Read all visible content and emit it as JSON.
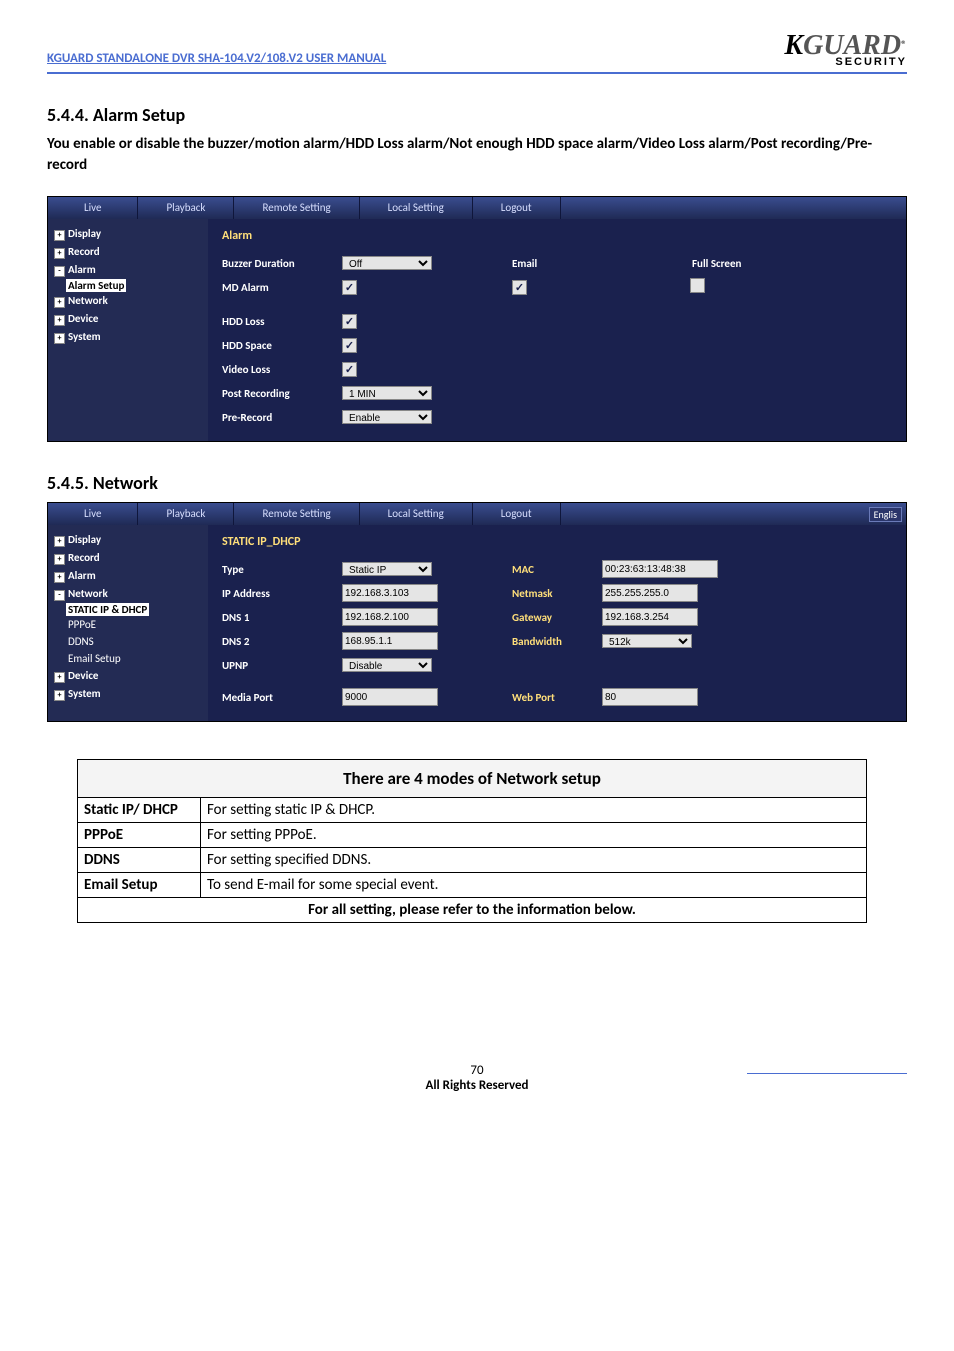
{
  "header": {
    "title": "KGUARD STANDALONE DVR SHA-104.V2/108.V2 USER MANUAL",
    "logo_k": "K",
    "logo_g": "GUARD",
    "logo_r": "®",
    "logo_sec": "SECURITY"
  },
  "sec1": {
    "h": "5.4.4. Alarm Setup",
    "body": "You enable or disable the buzzer/motion alarm/HDD Loss alarm/Not enough HDD space alarm/Video Loss alarm/Post recording/Pre-record"
  },
  "sec2": {
    "h": "5.4.5. Network"
  },
  "tabs": [
    "Live",
    "Playback",
    "Remote Setting",
    "Local Setting",
    "Logout"
  ],
  "lang": "Englis",
  "tree1": {
    "display": "Display",
    "record": "Record",
    "alarm": "Alarm",
    "alarm_setup": "Alarm Setup",
    "network": "Network",
    "device": "Device",
    "system": "System"
  },
  "tree2": {
    "display": "Display",
    "record": "Record",
    "alarm": "Alarm",
    "network": "Network",
    "static": "STATIC IP & DHCP",
    "pppoe": "PPPoE",
    "ddns": "DDNS",
    "email": "Email Setup",
    "device": "Device",
    "system": "System"
  },
  "alarm": {
    "title": "Alarm",
    "buzzer": "Buzzer Duration",
    "buzzer_val": "Off",
    "email": "Email",
    "full": "Full Screen",
    "md": "MD Alarm",
    "hdd": "HDD Loss",
    "hddsp": "HDD Space",
    "vloss": "Video Loss",
    "post": "Post Recording",
    "post_val": "1 MIN",
    "pre": "Pre-Record",
    "pre_val": "Enable"
  },
  "net": {
    "title": "STATIC IP_DHCP",
    "type": "Type",
    "type_val": "Static IP",
    "ip": "IP Address",
    "ip_val": "192.168.3.103",
    "dns1": "DNS 1",
    "dns1_val": "192.168.2.100",
    "dns2": "DNS 2",
    "dns2_val": "168.95.1.1",
    "upnp": "UPNP",
    "upnp_val": "Disable",
    "mport": "Media Port",
    "mport_val": "9000",
    "mac": "MAC",
    "mac_val": "00:23:63:13:48:38",
    "mask": "Netmask",
    "mask_val": "255.255.255.0",
    "gw": "Gateway",
    "gw_val": "192.168.3.254",
    "bw": "Bandwidth",
    "bw_val": "512k",
    "wport": "Web Port",
    "wport_val": "80"
  },
  "table": {
    "title": "There are 4 modes of Network setup",
    "r1a": "Static IP/ DHCP",
    "r1b": "For setting static IP & DHCP.",
    "r2a": "PPPoE",
    "r2b": "For setting PPPoE.",
    "r3a": "DDNS",
    "r3b": "For setting specified DDNS.",
    "r4a": "Email Setup",
    "r4b": "To send E-mail for some special event.",
    "foot": "For all setting, please refer to the information below."
  },
  "footer": {
    "page": "70",
    "rights": "All Rights Reserved"
  }
}
